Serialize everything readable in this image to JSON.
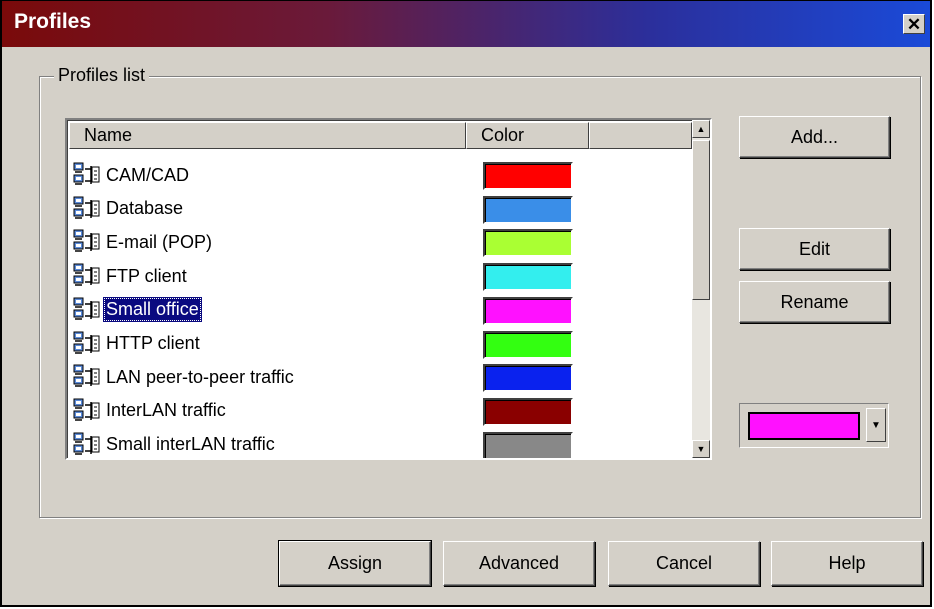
{
  "window": {
    "title": "Profiles",
    "close_glyph": "✕"
  },
  "group": {
    "label": "Profiles list"
  },
  "list": {
    "columns": [
      "Name",
      "Color",
      ""
    ],
    "rows": [
      {
        "name": "CAM/CAD",
        "color": "#ff0000",
        "selected": false
      },
      {
        "name": "Database",
        "color": "#3a8ee8",
        "selected": false
      },
      {
        "name": "E-mail (POP)",
        "color": "#aaff33",
        "selected": false
      },
      {
        "name": "FTP client",
        "color": "#33eeee",
        "selected": false
      },
      {
        "name": "Small office",
        "color": "#ff11ff",
        "selected": true
      },
      {
        "name": "HTTP client",
        "color": "#33ff11",
        "selected": false
      },
      {
        "name": "LAN peer-to-peer traffic",
        "color": "#0a22ee",
        "selected": false
      },
      {
        "name": "InterLAN traffic",
        "color": "#8a0000",
        "selected": false
      },
      {
        "name": "Small interLAN traffic",
        "color": "#888888",
        "selected": false
      }
    ],
    "row_icon": "network-profile-icon"
  },
  "side_buttons": {
    "add": "Add...",
    "edit": "Edit",
    "rename": "Rename"
  },
  "color_picker": {
    "value": "#ff11ff",
    "arrow_icon": "dropdown-arrow-icon"
  },
  "bottom_buttons": {
    "assign": "Assign",
    "advanced": "Advanced",
    "cancel": "Cancel",
    "help": "Help"
  }
}
